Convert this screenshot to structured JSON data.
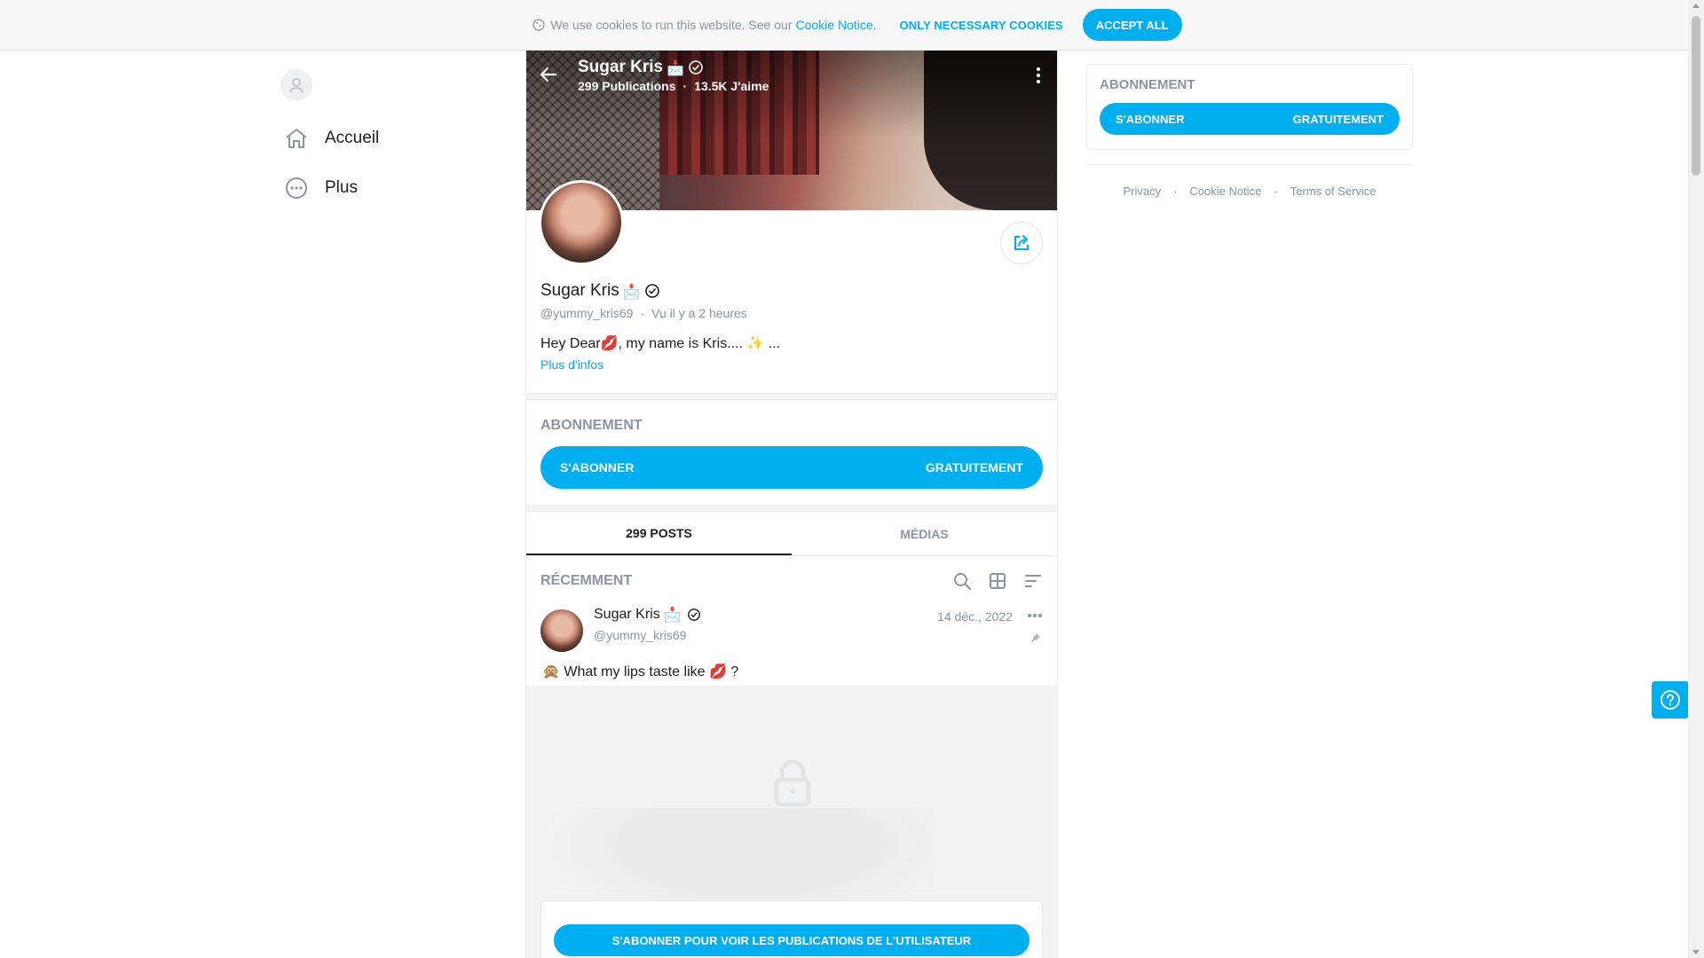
{
  "colors": {
    "accent": "#00aff0",
    "muted": "#8a96a3",
    "text": "#1c1c1c"
  },
  "cookie": {
    "message": "We use cookies to run this website. See our",
    "link": "Cookie Notice.",
    "necessary": "ONLY NECESSARY COOKIES",
    "accept": "ACCEPT ALL",
    "icon": "cookie-icon"
  },
  "sidebar": {
    "items": [
      {
        "label": "Accueil",
        "icon": "home-icon"
      },
      {
        "label": "Plus",
        "icon": "more-circle-icon"
      }
    ]
  },
  "cover": {
    "name": "Sugar Kris",
    "name_emoji": "📩",
    "publications": "299 Publications",
    "likes": "13.5K J'aime"
  },
  "profile": {
    "name": "Sugar Kris",
    "name_emoji": "📩",
    "handle": "@yummy_kris69",
    "seen": "Vu  il y a 2 heures",
    "bio": "Hey Dear💋, my name is Kris.... ✨ ...",
    "more_info": "Plus d'infos"
  },
  "subscription": {
    "title": "ABONNEMENT",
    "subscribe": "S'ABONNER",
    "price": "GRATUITEMENT"
  },
  "tabs": [
    {
      "label": "299 POSTS",
      "active": true
    },
    {
      "label": "MÉDIAS",
      "active": false
    }
  ],
  "feed": {
    "title": "RÉCEMMENT",
    "post": {
      "author": "Sugar Kris",
      "author_emoji": "📩",
      "handle": "@yummy_kris69",
      "date": "14 déc., 2022",
      "text": "🙊 What my lips taste like 💋 ?",
      "locked_button": "S'ABONNER POUR VOIR LES PUBLICATIONS DE L'UTILISATEUR"
    }
  },
  "right": {
    "title": "ABONNEMENT",
    "subscribe": "S'ABONNER",
    "price": "GRATUITEMENT",
    "links": [
      "Privacy",
      "Cookie Notice",
      "Terms of Service"
    ]
  }
}
